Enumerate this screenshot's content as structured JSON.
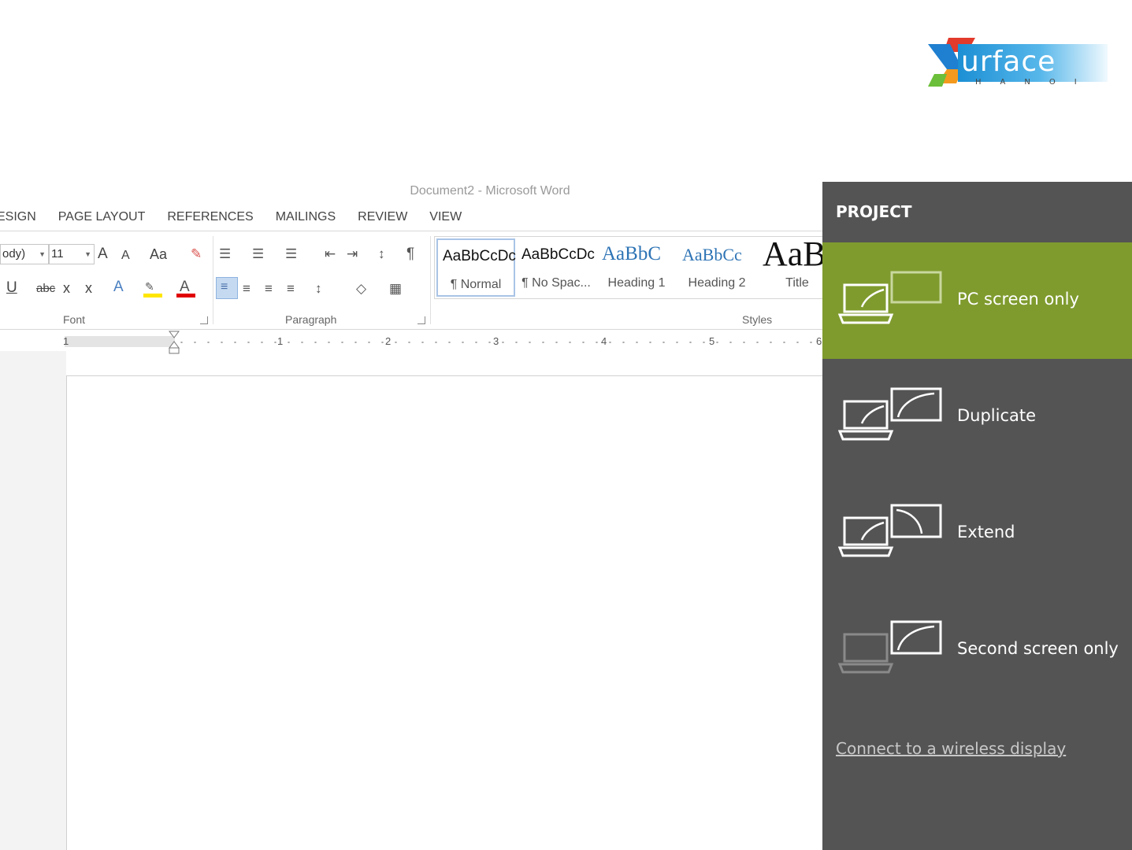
{
  "logo": {
    "text": "urface",
    "sub": "HANOI"
  },
  "word": {
    "title": "Document2 - Microsoft Word",
    "tabs": [
      "ESIGN",
      "PAGE LAYOUT",
      "REFERENCES",
      "MAILINGS",
      "REVIEW",
      "VIEW"
    ],
    "font": {
      "name_value": "ody)",
      "size_value": "11",
      "grow_label": "A",
      "shrink_label": "A",
      "case_label": "Aa",
      "underline_label": "U",
      "strike_label": "abc",
      "subscript_label": "x",
      "superscript_label": "x",
      "group_label": "Font"
    },
    "paragraph": {
      "group_label": "Paragraph"
    },
    "styles": {
      "group_label": "Styles",
      "tiles": [
        {
          "sample": "AaBbCcDc",
          "name": "¶ Normal"
        },
        {
          "sample": "AaBbCcDc",
          "name": "¶ No Spac..."
        },
        {
          "sample": "AaBbC",
          "name": "Heading 1"
        },
        {
          "sample": "AaBbCc",
          "name": "Heading 2"
        },
        {
          "sample": "AaB",
          "name": "Title"
        }
      ]
    },
    "ruler": {
      "marks": [
        "1",
        "1",
        "2",
        "3",
        "4",
        "5",
        "6"
      ]
    }
  },
  "project": {
    "title": "PROJECT",
    "options": [
      {
        "label": "PC screen only",
        "selected": true
      },
      {
        "label": "Duplicate",
        "selected": false
      },
      {
        "label": "Extend",
        "selected": false
      },
      {
        "label": "Second screen only",
        "selected": false
      }
    ],
    "wireless_link": "Connect to a wireless display"
  },
  "colors": {
    "panel_bg": "#545454",
    "selected_option": "#7f9b2e",
    "link": "#c8c8c8",
    "logo_blue": "#1c8fd4"
  }
}
